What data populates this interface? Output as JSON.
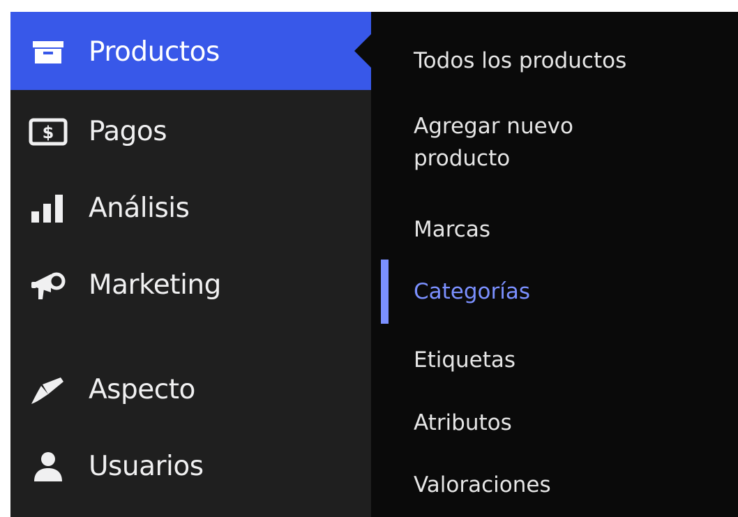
{
  "menu": {
    "items": [
      {
        "label": "Productos",
        "icon": "archive-box-icon"
      },
      {
        "label": "Pagos",
        "icon": "money-icon"
      },
      {
        "label": "Análisis",
        "icon": "bar-chart-icon"
      },
      {
        "label": "Marketing",
        "icon": "megaphone-icon"
      },
      {
        "label": "Aspecto",
        "icon": "paintbrush-icon"
      },
      {
        "label": "Usuarios",
        "icon": "user-icon"
      }
    ],
    "current": "Productos"
  },
  "submenu": {
    "items": [
      {
        "label": "Todos los productos"
      },
      {
        "label": "Agregar nuevo producto"
      },
      {
        "label": "Marcas"
      },
      {
        "label": "Categorías"
      },
      {
        "label": "Etiquetas"
      },
      {
        "label": "Atributos"
      },
      {
        "label": "Valoraciones"
      }
    ],
    "current": "Categorías"
  },
  "colors": {
    "menu_bg": "#1f1f1f",
    "submenu_bg": "#0a0a0a",
    "accent": "#3858e9",
    "current_sub": "#7b90ff",
    "text": "#f0f0f1"
  }
}
